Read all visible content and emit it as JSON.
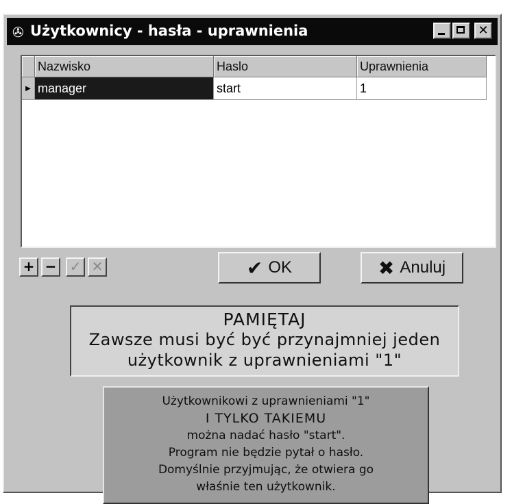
{
  "window": {
    "title": "Użytkownicy - hasła - uprawnienia",
    "icon": "key-icon",
    "close_glyph": "✕"
  },
  "grid": {
    "columns": [
      "Nazwisko",
      "Haslo",
      "Uprawnienia"
    ],
    "rows": [
      {
        "indicator": "▶",
        "nazwisko": "manager",
        "haslo": "start",
        "uprawnienia": "1"
      }
    ]
  },
  "navigator": {
    "add": "+",
    "delete": "−",
    "post": "✓",
    "cancel": "✕"
  },
  "buttons": {
    "ok_icon": "✔",
    "ok_label": "OK",
    "cancel_icon": "✖",
    "cancel_label": "Anuluj"
  },
  "reminder": {
    "heading": "PAMIĘTAJ",
    "line1": "Zawsze musi być być przynajmniej jeden",
    "line2": "użytkownik z uprawnieniami \"1\""
  },
  "info": {
    "line1": "Użytkownikowi z uprawnieniami \"1\"",
    "line2": "I TYLKO TAKIEMU",
    "line3": "można nadać hasło \"start\".",
    "line4": "Program nie będzie pytał o hasło.",
    "line5": "Domyślnie przyjmując, że otwiera go",
    "line6": "właśnie ten użytkownik."
  },
  "colors": {
    "titlebar": "#0a0a0a",
    "face": "#c3c3c3",
    "selection": "#1a1a1a"
  }
}
